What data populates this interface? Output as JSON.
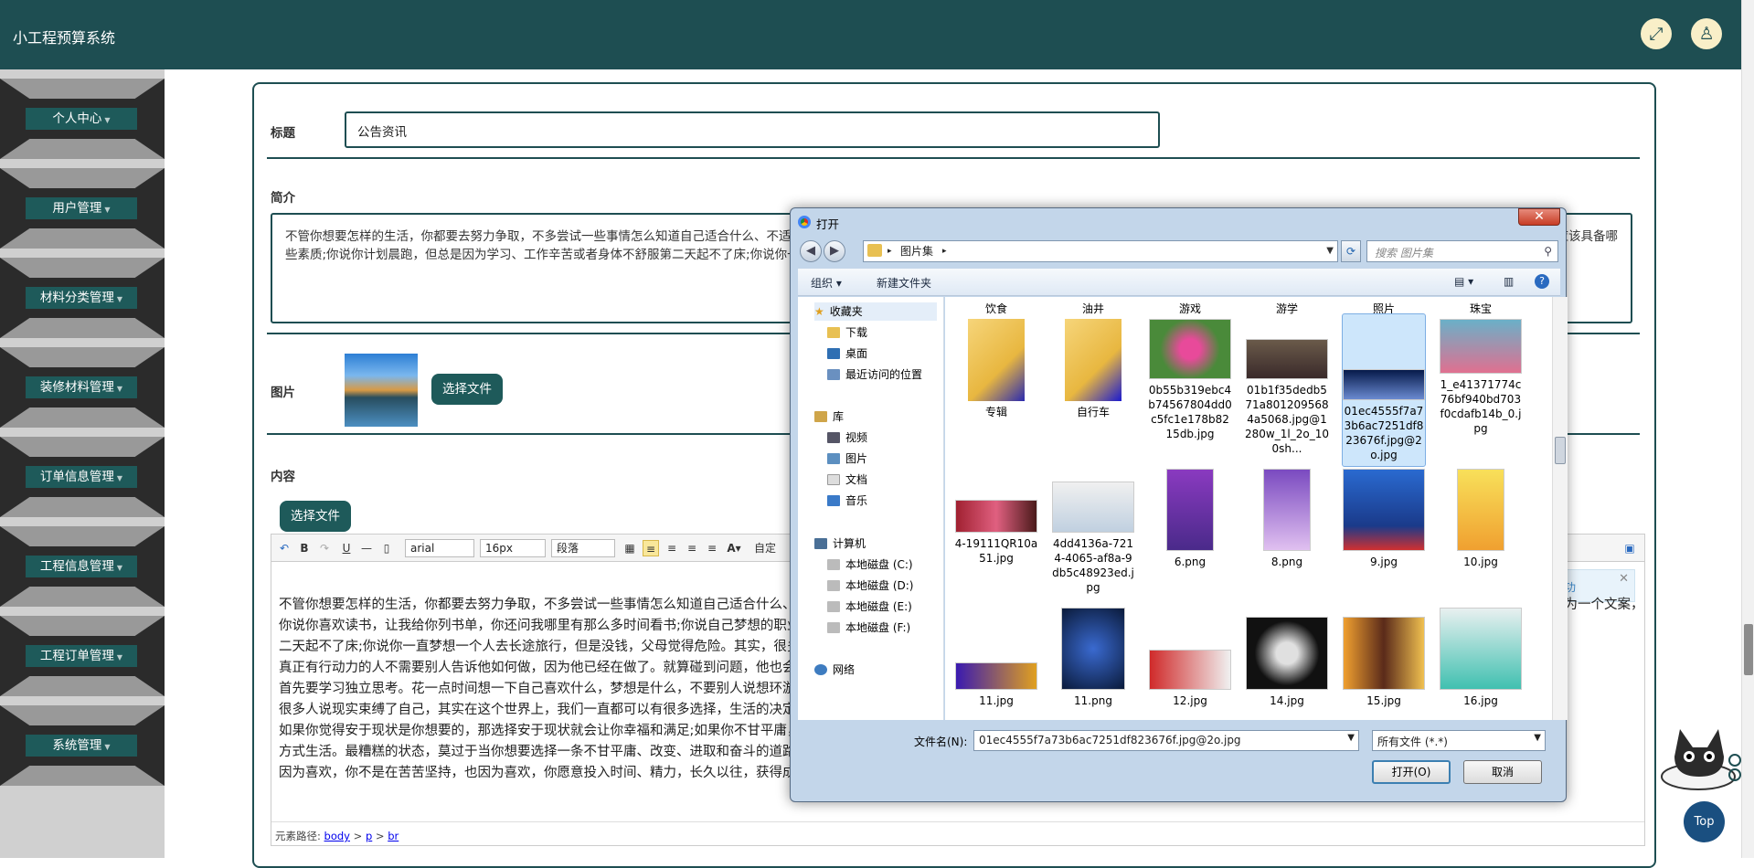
{
  "app": {
    "title": "小工程预算系统"
  },
  "sidebar": {
    "items": [
      {
        "label": "个人中心"
      },
      {
        "label": "用户管理"
      },
      {
        "label": "材料分类管理"
      },
      {
        "label": "装修材料管理"
      },
      {
        "label": "订单信息管理"
      },
      {
        "label": "工程信息管理"
      },
      {
        "label": "工程订单管理"
      },
      {
        "label": "系统管理"
      }
    ]
  },
  "form": {
    "title_label": "标题",
    "title_value": "公告资讯",
    "intro_label": "简介",
    "intro_text": "不管你想要怎样的生活，你都要去努力争取，不多尝试一些事情怎么知道自己适合什么、不适合什么呢？你说你喜欢读书，让我给你列书单，你还问我哪里有那么多时间看书；你说自己梦想的职业是广告文案，问我如何成为一个文案，应该具备哪些素质;你说你计划晨跑，但总是因为学习、工作辛苦或者身体不舒服第二天起不了床;你说你一直梦想一个人去长途旅行，但是没钱，父母觉得危险。",
    "image_label": "图片",
    "choose_file": "选择文件",
    "content_label": "内容"
  },
  "editor": {
    "font_family": "arial",
    "font_size": "16px",
    "paragraph": "段落",
    "custom": "自定",
    "notice": "成功",
    "paragraphs": [
      "不管你想要怎样的生活，你都要去努力争取，不多尝试一些事情怎么知道自己适合什么、不适合什么呢？你说你喜欢读书，让我给你列书单，你还问我哪里有那么多时间看书；你说自己梦想的职业是广告文案，问我如何成为一个文案，应该具备哪些素质",
      "你说你喜欢读书，让我给你列书单，你还问我哪里有那么多时间看书;你说自己梦想的职业是广告文案，问我如何成为一个文案，应该具备哪些素质;你说你计划晨跑，但总是因为学习、工作辛苦或者身体不舒服第",
      "二天起不了床;你说你一直梦想一个人去长途旅行，但是没钱，父母觉得危险。其实，很多时候，我们在想法上显得特别勤快，但在行动上却显得特别懒惰。",
      "真正有行动力的人不需要别人告诉他如何做，因为他已经在做了。就算碰到问题，他也会自己想办法，自己动手去解决或者主动寻找可以帮助他的人。",
      "首先要学习独立思考。花一点时间想一下自己喜欢什么，梦想是什么，不要别人说想环游世界，你就说你的梦想是环游世界。",
      "很多人说现实束缚了自己，其实在这个世界上，我们一直都可以有很多选择，生活的决定权也一直都在自己手上，只是我们缺乏行动力而已。",
      "如果你觉得安于现状是你想要的，那选择安于现状就会让你幸福和满足;如果你不甘平庸，选择一条改变、进取和奋斗的道路，在这个追求的过程中，你也一样会感到快乐。所谓的成功，即是按照自己想要的生活",
      "方式生活。最糟糕的状态，莫过于当你想要选择一条不甘平庸、改变、进取和奋斗的道路时，却又因为懒惰、犹豫和害怕而裹足不前。",
      "因为喜欢，你不是在苦苦坚持，也因为喜欢，你愿意投入时间、精力，长久以往，获得成果就是自然而然的事情。"
    ],
    "path_label": "元素路径:",
    "path_body": "body",
    "path_sep1": ">",
    "path_p": "p",
    "path_sep2": ">",
    "path_br": "br"
  },
  "dialog": {
    "title": "打开",
    "close": "✕",
    "address": "图片集",
    "search_placeholder": "搜索 图片集",
    "organize": "组织 ▾",
    "new_folder": "新建文件夹",
    "nav": {
      "favorites": "收藏夹",
      "downloads": "下载",
      "desktop": "桌面",
      "recent": "最近访问的位置",
      "library": "库",
      "videos": "视频",
      "pictures": "图片",
      "documents": "文档",
      "music": "音乐",
      "computer": "计算机",
      "drive_c": "本地磁盘 (C:)",
      "drive_d": "本地磁盘 (D:)",
      "drive_e": "本地磁盘 (E:)",
      "drive_f": "本地磁盘 (F:)",
      "network": "网络"
    },
    "column_headers": [
      "饮食",
      "油井",
      "游戏",
      "游学",
      "照片",
      "珠宝"
    ],
    "files": [
      "专辑",
      "自行车",
      "0b55b319ebc4b74567804dd0c5fc1e178b8215db.jpg",
      "01b1f35dedb571a8012095684a5068.jpg@1280w_1l_2o_100sh...",
      "01ec4555f7a73b6ac7251df823676f.jpg@2o.jpg",
      "1_e41371774c76bf940bd703f0cdafb14b_0.jpg",
      "4-19111QR10a51.jpg",
      "4dd4136a-7214-4065-af8a-9db5c48923ed.jpg",
      "6.png",
      "8.png",
      "9.jpg",
      "10.jpg",
      "11.jpg",
      "11.png",
      "12.jpg",
      "14.jpg",
      "15.jpg",
      "16.jpg"
    ],
    "filename_label": "文件名(N):",
    "filename_value": "01ec4555f7a73b6ac7251df823676f.jpg@2o.jpg",
    "filter_value": "所有文件 (*.*)",
    "open_button": "打开(O)",
    "cancel_button": "取消"
  },
  "fab": {
    "top": "Top"
  }
}
